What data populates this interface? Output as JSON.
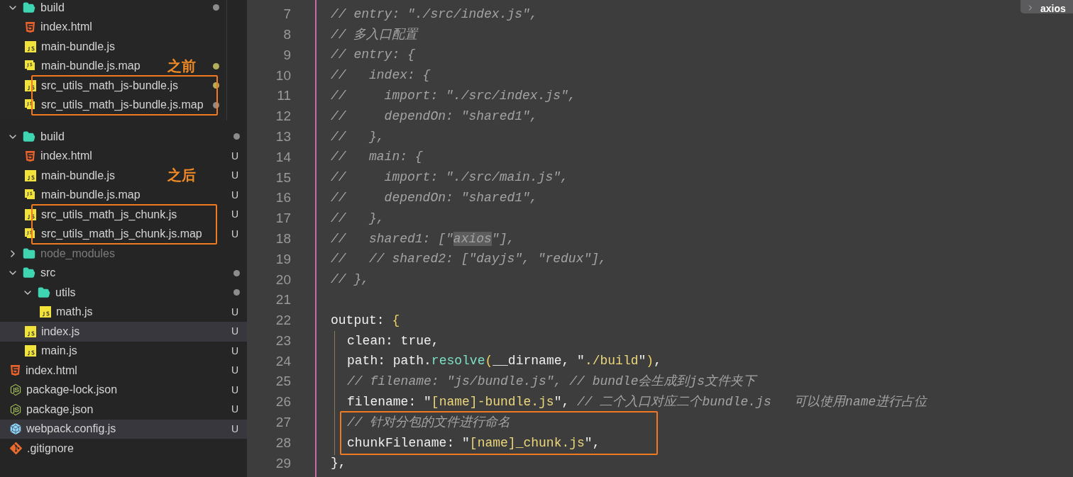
{
  "explorer_before": {
    "items": [
      {
        "kind": "folder",
        "label": "build",
        "expanded": true,
        "selected": false,
        "dimmed": false,
        "color": "#8c8c8c",
        "children": [
          {
            "kind": "html",
            "label": "index.html",
            "selected": false,
            "dimmed": false
          },
          {
            "kind": "js",
            "label": "main-bundle.js",
            "selected": false,
            "dimmed": false
          },
          {
            "kind": "jsmap",
            "label": "main-bundle.js.map",
            "annotation": "之前",
            "selected": false,
            "dimmed": false,
            "color": "#b3ad5c"
          },
          {
            "kind": "box",
            "children": [
              {
                "kind": "js",
                "label": "src_utils_math_js-bundle.js",
                "selected": false,
                "dimmed": false,
                "color": "#b3ad5c"
              },
              {
                "kind": "jsmap",
                "label": "src_utils_math_js-bundle.js.map",
                "selected": false,
                "dimmed": false,
                "color": "#8c8c8c"
              }
            ]
          }
        ]
      }
    ]
  },
  "explorer_after": {
    "items": [
      {
        "kind": "folder",
        "label": "build",
        "expanded": true,
        "selected": false,
        "dimmed": false,
        "color": "#8c8c8c",
        "children": [
          {
            "kind": "html",
            "label": "index.html",
            "badge": "U",
            "selected": false,
            "dimmed": false
          },
          {
            "kind": "js",
            "label": "main-bundle.js",
            "annotation": "之后",
            "badge": "U",
            "selected": false,
            "dimmed": false
          },
          {
            "kind": "jsmap",
            "label": "main-bundle.js.map",
            "badge": "U",
            "selected": false,
            "dimmed": false
          },
          {
            "kind": "box",
            "children": [
              {
                "kind": "js",
                "label": "src_utils_math_js_chunk.js",
                "badge": "U",
                "selected": false,
                "dimmed": false
              },
              {
                "kind": "jsmap",
                "label": "src_utils_math_js_chunk.js.map",
                "badge": "U",
                "selected": false,
                "dimmed": false
              }
            ]
          }
        ]
      },
      {
        "kind": "folder",
        "label": "node_modules",
        "expanded": false,
        "selected": false,
        "dimmed": true
      },
      {
        "kind": "folder",
        "label": "src",
        "expanded": true,
        "selected": false,
        "dimmed": false,
        "color": "#8c8c8c",
        "children": [
          {
            "kind": "folder",
            "label": "utils",
            "expanded": true,
            "selected": false,
            "dimmed": false,
            "color": "#8c8c8c",
            "children": [
              {
                "kind": "js",
                "label": "math.js",
                "badge": "U",
                "selected": false,
                "dimmed": false
              }
            ]
          },
          {
            "kind": "js",
            "label": "index.js",
            "badge": "U",
            "selected": true,
            "dimmed": false
          },
          {
            "kind": "js",
            "label": "main.js",
            "badge": "U",
            "selected": false,
            "dimmed": false
          }
        ]
      },
      {
        "kind": "html",
        "label": "index.html",
        "badge": "U",
        "selected": false,
        "dimmed": false
      },
      {
        "kind": "node",
        "label": "package-lock.json",
        "badge": "U",
        "selected": false,
        "dimmed": false
      },
      {
        "kind": "node",
        "label": "package.json",
        "badge": "U",
        "selected": false,
        "dimmed": false
      },
      {
        "kind": "webpack",
        "label": "webpack.config.js",
        "badge": "U",
        "selected": true,
        "dimmed": false
      },
      {
        "kind": "git",
        "label": ".gitignore",
        "selected": false,
        "dimmed": false
      }
    ]
  },
  "editor": {
    "find_widget": {
      "value": "axios"
    },
    "lines": [
      {
        "kind": "line",
        "number": "7",
        "tokens": [
          {
            "kind": "comment",
            "t": "// entry: \"./src/index.js\","
          }
        ]
      },
      {
        "kind": "line",
        "number": "8",
        "tokens": [
          {
            "kind": "comment",
            "t": "// 多入口配置"
          }
        ]
      },
      {
        "kind": "line",
        "number": "9",
        "tokens": [
          {
            "kind": "comment",
            "t": "// entry: {"
          }
        ]
      },
      {
        "kind": "line",
        "number": "10",
        "tokens": [
          {
            "kind": "comment",
            "t": "//   index: {"
          }
        ]
      },
      {
        "kind": "line",
        "number": "11",
        "tokens": [
          {
            "kind": "comment",
            "t": "//     import: \"./src/index.js\","
          }
        ]
      },
      {
        "kind": "line",
        "number": "12",
        "tokens": [
          {
            "kind": "comment",
            "t": "//     dependOn: \"shared1\","
          }
        ]
      },
      {
        "kind": "line",
        "number": "13",
        "tokens": [
          {
            "kind": "comment",
            "t": "//   },"
          }
        ]
      },
      {
        "kind": "line",
        "number": "14",
        "tokens": [
          {
            "kind": "comment",
            "t": "//   main: {"
          }
        ]
      },
      {
        "kind": "line",
        "number": "15",
        "tokens": [
          {
            "kind": "comment",
            "t": "//     import: \"./src/main.js\","
          }
        ]
      },
      {
        "kind": "line",
        "number": "16",
        "tokens": [
          {
            "kind": "comment",
            "t": "//     dependOn: \"shared1\","
          }
        ]
      },
      {
        "kind": "line",
        "number": "17",
        "tokens": [
          {
            "kind": "comment",
            "t": "//   },"
          }
        ]
      },
      {
        "kind": "line",
        "number": "18",
        "tokens": [
          {
            "kind": "comment",
            "t": "//   shared1: [\""
          },
          {
            "kind": "match",
            "t": "axios"
          },
          {
            "kind": "comment",
            "t": "\"],"
          }
        ]
      },
      {
        "kind": "line",
        "number": "19",
        "tokens": [
          {
            "kind": "comment",
            "t": "//   // shared2: [\"dayjs\", \"redux\"],"
          }
        ]
      },
      {
        "kind": "line",
        "number": "20",
        "tokens": [
          {
            "kind": "comment",
            "t": "// },"
          }
        ]
      },
      {
        "kind": "line",
        "number": "21"
      },
      {
        "kind": "line",
        "number": "22",
        "tokens": [
          {
            "kind": "plain",
            "t": "output: "
          },
          {
            "kind": "brace",
            "t": "{"
          }
        ]
      },
      {
        "kind": "block",
        "children": [
          {
            "kind": "line",
            "number": "23",
            "tokens": [
              {
                "kind": "plain",
                "t": "clean: true,"
              }
            ]
          },
          {
            "kind": "line",
            "number": "24",
            "tokens": [
              {
                "kind": "plain",
                "t": "path: path."
              },
              {
                "kind": "func",
                "t": "resolve"
              },
              {
                "kind": "brace",
                "t": "("
              },
              {
                "kind": "plain",
                "t": "__dirname, \""
              },
              {
                "kind": "string",
                "t": "./build"
              },
              {
                "kind": "plain",
                "t": "\""
              },
              {
                "kind": "brace",
                "t": ")"
              },
              {
                "kind": "plain",
                "t": ","
              }
            ]
          },
          {
            "kind": "line",
            "number": "25",
            "tokens": [
              {
                "kind": "comment",
                "t": "// filename: \"js/bundle.js\", // bundle会生成到js文件夹下"
              }
            ]
          },
          {
            "kind": "line",
            "number": "26",
            "tokens": [
              {
                "kind": "plain",
                "t": "filename: \""
              },
              {
                "kind": "string",
                "t": "[name]-bundle.js"
              },
              {
                "kind": "plain",
                "t": "\", "
              },
              {
                "kind": "comment",
                "t": "// 二个入口对应二个bundle.js   可以使用name进行占位"
              }
            ]
          },
          {
            "kind": "box",
            "children": [
              {
                "kind": "line",
                "number": "27",
                "tokens": [
                  {
                    "kind": "comment",
                    "t": "// 针对分包的文件进行命名"
                  }
                ]
              },
              {
                "kind": "line",
                "number": "28",
                "tokens": [
                  {
                    "kind": "plain",
                    "t": "chunkFilename: \""
                  },
                  {
                    "kind": "string",
                    "t": "[name]_chunk.js"
                  },
                  {
                    "kind": "plain",
                    "t": "\","
                  }
                ]
              }
            ]
          }
        ]
      },
      {
        "kind": "line",
        "number": "29",
        "tokens": [
          {
            "kind": "plain",
            "t": "},"
          }
        ]
      }
    ]
  }
}
